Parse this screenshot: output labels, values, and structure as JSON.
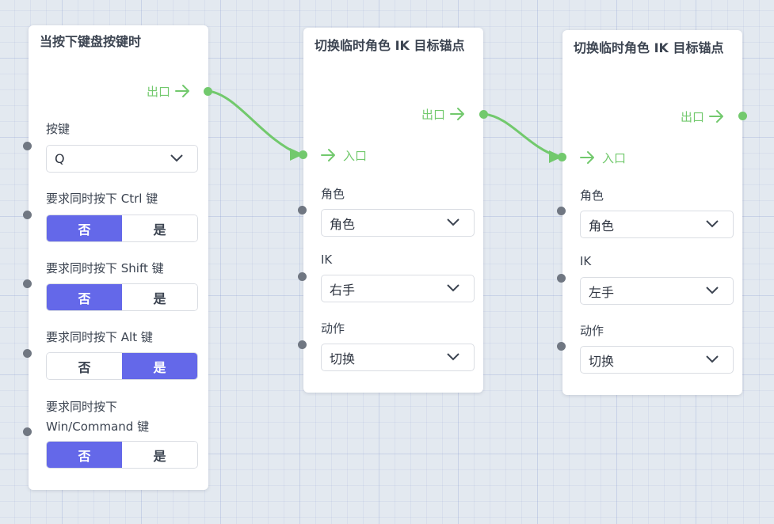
{
  "colors": {
    "accent": "#6468e9",
    "flow": "#72c96d",
    "pin": "#707782"
  },
  "icons": {
    "arrow": "arrow-right-icon",
    "dropdown": "chevron-down-icon"
  },
  "node1": {
    "title": "当按下键盘按键时",
    "exit_label": "出口",
    "key_label": "按键",
    "key_value": "Q",
    "ctrl_label": "要求同时按下 Ctrl 键",
    "ctrl_no": "否",
    "ctrl_yes": "是",
    "ctrl_selected": "否",
    "shift_label": "要求同时按下 Shift 键",
    "shift_no": "否",
    "shift_yes": "是",
    "shift_selected": "否",
    "alt_label": "要求同时按下 Alt 键",
    "alt_no": "否",
    "alt_yes": "是",
    "alt_selected": "是",
    "win_label_line1": "要求同时按下",
    "win_label_line2": "Win/Command 键",
    "win_no": "否",
    "win_yes": "是",
    "win_selected": "否"
  },
  "node2": {
    "title": "切换临时角色 IK 目标锚点",
    "exit_label": "出口",
    "entry_label": "入口",
    "role_label": "角色",
    "role_value": "角色",
    "ik_label": "IK",
    "ik_value": "右手",
    "action_label": "动作",
    "action_value": "切换"
  },
  "node3": {
    "title": "切换临时角色 IK 目标锚点",
    "exit_label": "出口",
    "entry_label": "入口",
    "role_label": "角色",
    "role_value": "角色",
    "ik_label": "IK",
    "ik_value": "左手",
    "action_label": "动作",
    "action_value": "切换"
  }
}
